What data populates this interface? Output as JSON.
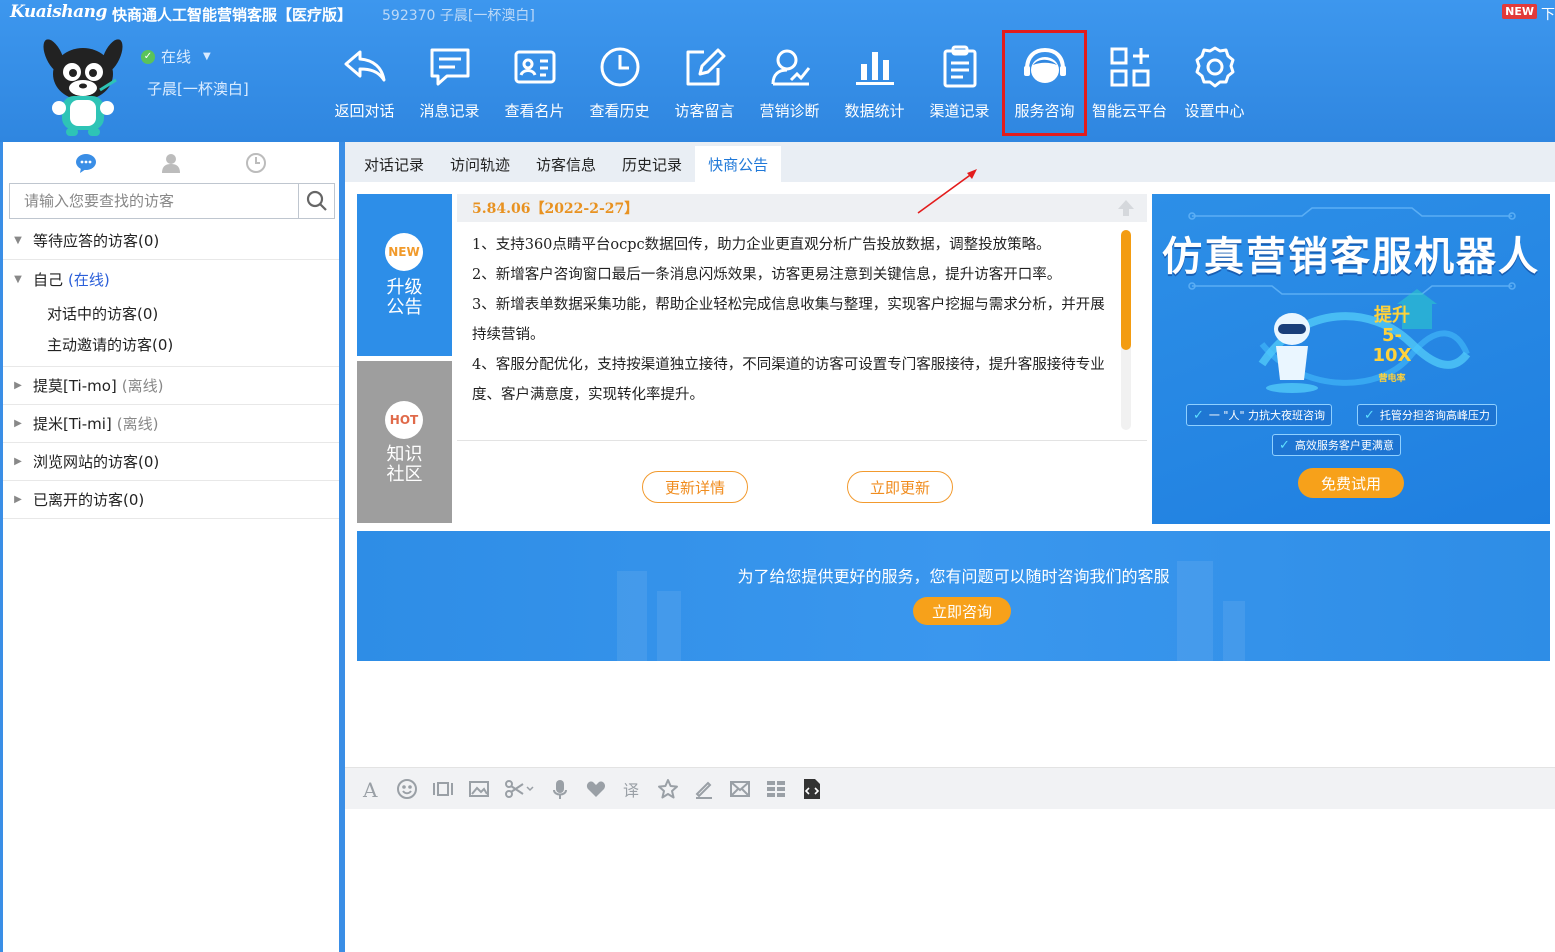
{
  "app": {
    "brand": "Kuaishang",
    "title": "快商通人工智能营销客服【医疗版】",
    "subtitle": "592370 子晨[一杯澳白]",
    "new_badge": "NEW",
    "title_right": "下"
  },
  "user": {
    "status": "在线",
    "name": "子晨[一杯澳白]"
  },
  "toolbar": [
    {
      "label": "返回对话",
      "icon": "back-arrow-icon"
    },
    {
      "label": "消息记录",
      "icon": "message-icon"
    },
    {
      "label": "查看名片",
      "icon": "card-icon"
    },
    {
      "label": "查看历史",
      "icon": "clock-icon"
    },
    {
      "label": "访客留言",
      "icon": "edit-note-icon"
    },
    {
      "label": "营销诊断",
      "icon": "diagnosis-icon"
    },
    {
      "label": "数据统计",
      "icon": "bar-chart-icon"
    },
    {
      "label": "渠道记录",
      "icon": "clipboard-icon"
    },
    {
      "label": "服务咨询",
      "icon": "customer-service-icon",
      "active": true
    },
    {
      "label": "智能云平台",
      "icon": "grid-plus-icon"
    },
    {
      "label": "设置中心",
      "icon": "gear-icon"
    }
  ],
  "left": {
    "tab_icons": [
      "chat-icon",
      "user-icon",
      "history-icon"
    ],
    "search_placeholder": "请输入您要查找的访客",
    "groups": [
      {
        "label": "等待应答的访客(0)",
        "expanded": true
      },
      {
        "label": "自己",
        "status": "(在线)",
        "expanded": true,
        "children": [
          "对话中的访客(0)",
          "主动邀请的访客(0)"
        ]
      },
      {
        "label": "提莫[Ti-mo]",
        "status": "(离线)",
        "expanded": false
      },
      {
        "label": "提米[Ti-mi]",
        "status": "(离线)",
        "expanded": false
      },
      {
        "label": "浏览网站的访客(0)",
        "expanded": false
      },
      {
        "label": "已离开的访客(0)",
        "expanded": false
      }
    ]
  },
  "tabs": [
    {
      "label": "对话记录"
    },
    {
      "label": "访问轨迹"
    },
    {
      "label": "访客信息"
    },
    {
      "label": "历史记录"
    },
    {
      "label": "快商公告",
      "active": true
    }
  ],
  "side": {
    "new_badge": "NEW",
    "new_label_1": "升级",
    "new_label_2": "公告",
    "hot_badge": "HOT",
    "hot_label_1": "知识",
    "hot_label_2": "社区"
  },
  "notice": {
    "version": "5.84.06【2022-2-27】",
    "items": [
      "1、支持360点睛平台ocpc数据回传，助力企业更直观分析广告投放数据，调整投放策略。",
      "2、新增客户咨询窗口最后一条消息闪烁效果，访客更易注意到关键信息，提升访客开口率。",
      "3、新增表单数据采集功能，帮助企业轻松完成信息收集与整理，实现客户挖掘与需求分析，并开展持续营销。",
      "4、客服分配优化，支持按渠道独立接待，不同渠道的访客可设置专门客服接待，提升客服接待专业度、客户满意度，实现转化率提升。"
    ],
    "scroll_fraction": 0.6,
    "btn_detail": "更新详情",
    "btn_update": "立即更新"
  },
  "ad": {
    "title": "仿真营销客服机器人",
    "boost_1": "提升",
    "boost_2": "5-10X",
    "boost_3": "营电率",
    "feat_1": "一 \"人\" 力抗大夜班咨询",
    "feat_2": "托管分担咨询高峰压力",
    "feat_3": "高效服务客户更满意",
    "btn": "免费试用"
  },
  "contact": {
    "text": "为了给您提供更好的服务，您有问题可以随时咨询我们的客服",
    "btn": "立即咨询"
  },
  "editor_icons": [
    "font-icon",
    "emoji-icon",
    "screenshot-frame-icon",
    "image-icon",
    "scissors-icon",
    "microphone-icon",
    "heart-icon",
    "translate-icon",
    "star-icon",
    "pen-icon",
    "mail-icon",
    "list-icon",
    "code-file-icon"
  ],
  "colors": {
    "brand_blue": "#3a8ee6",
    "accent_orange": "#f39c12",
    "highlight_red": "#e31c1c",
    "tab_active": "#1f78d8"
  }
}
